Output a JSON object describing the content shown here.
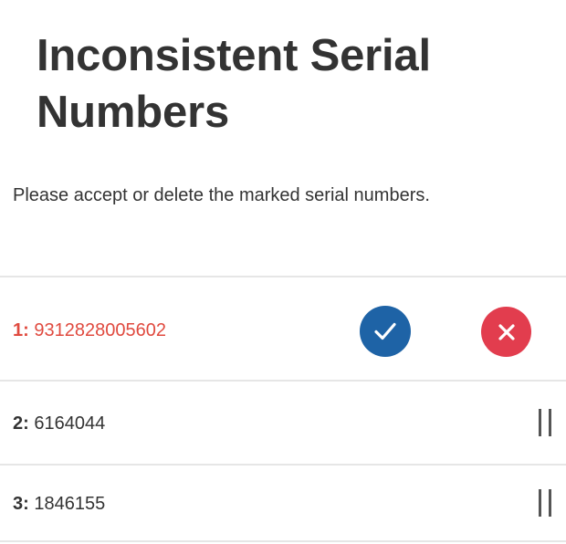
{
  "page": {
    "title": "Inconsistent Serial Numbers",
    "instructions": "Please accept or delete the marked serial numbers."
  },
  "serials": [
    {
      "index": "1:",
      "number": "9312828005602",
      "marked": true,
      "text_color": "#e04a3f"
    },
    {
      "index": "2:",
      "number": "6164044",
      "marked": false
    },
    {
      "index": "3:",
      "number": "1846155",
      "marked": false
    }
  ],
  "actions": {
    "accept_icon": "checkmark-icon",
    "accept_color": "#1e63a6",
    "delete_icon": "x-mark-icon",
    "delete_color": "#e23d4e",
    "reorder_icon": "drag-handle-icon"
  }
}
